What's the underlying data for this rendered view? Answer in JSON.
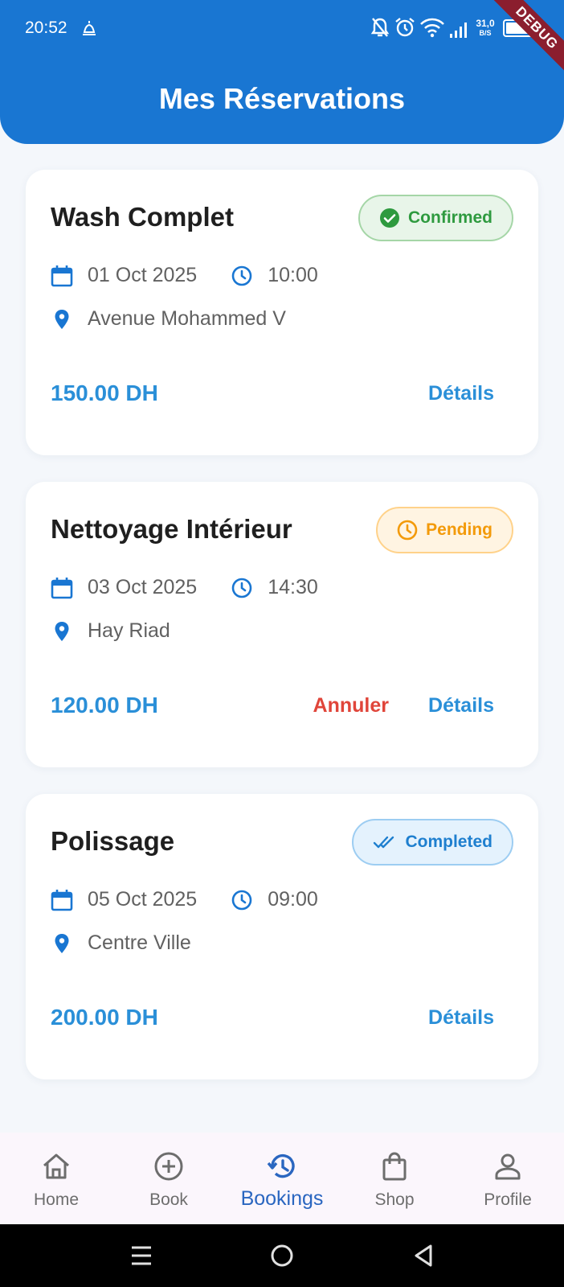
{
  "status_bar": {
    "time": "20:52",
    "net_speed_value": "31,0",
    "net_speed_unit": "B/S",
    "debug_banner": "DEBUG",
    "icons": [
      "silent-mode-icon",
      "bell-off-icon",
      "alarm-icon",
      "wifi-icon",
      "signal-icon",
      "battery-icon"
    ]
  },
  "header": {
    "title": "Mes Réservations"
  },
  "colors": {
    "primary": "#1976d2",
    "price": "#2a8fd8",
    "cancel": "#e0453a",
    "confirmed": "#2e9a3f",
    "pending": "#f39a0a",
    "completed": "#1e7fcf"
  },
  "bookings": [
    {
      "title": "Wash Complet",
      "status": "Confirmed",
      "status_icon": "check-circle-icon",
      "date": "01 Oct 2025",
      "time": "10:00",
      "location": "Avenue Mohammed V",
      "price": "150.00 DH",
      "details_label": "Détails"
    },
    {
      "title": "Nettoyage Intérieur",
      "status": "Pending",
      "status_icon": "clock-icon",
      "date": "03 Oct 2025",
      "time": "14:30",
      "location": "Hay Riad",
      "price": "120.00 DH",
      "cancel_label": "Annuler",
      "details_label": "Détails"
    },
    {
      "title": "Polissage",
      "status": "Completed",
      "status_icon": "double-check-icon",
      "date": "05 Oct 2025",
      "time": "09:00",
      "location": "Centre Ville",
      "price": "200.00 DH",
      "details_label": "Détails"
    }
  ],
  "bottom_nav": {
    "active": "Bookings",
    "items": [
      {
        "label": "Home",
        "icon": "home-icon"
      },
      {
        "label": "Book",
        "icon": "add-circle-icon"
      },
      {
        "label": "Bookings",
        "icon": "history-icon"
      },
      {
        "label": "Shop",
        "icon": "shopping-bag-icon"
      },
      {
        "label": "Profile",
        "icon": "person-icon"
      }
    ]
  },
  "system_nav": [
    "menu-icon",
    "home-circle-icon",
    "back-triangle-icon"
  ]
}
